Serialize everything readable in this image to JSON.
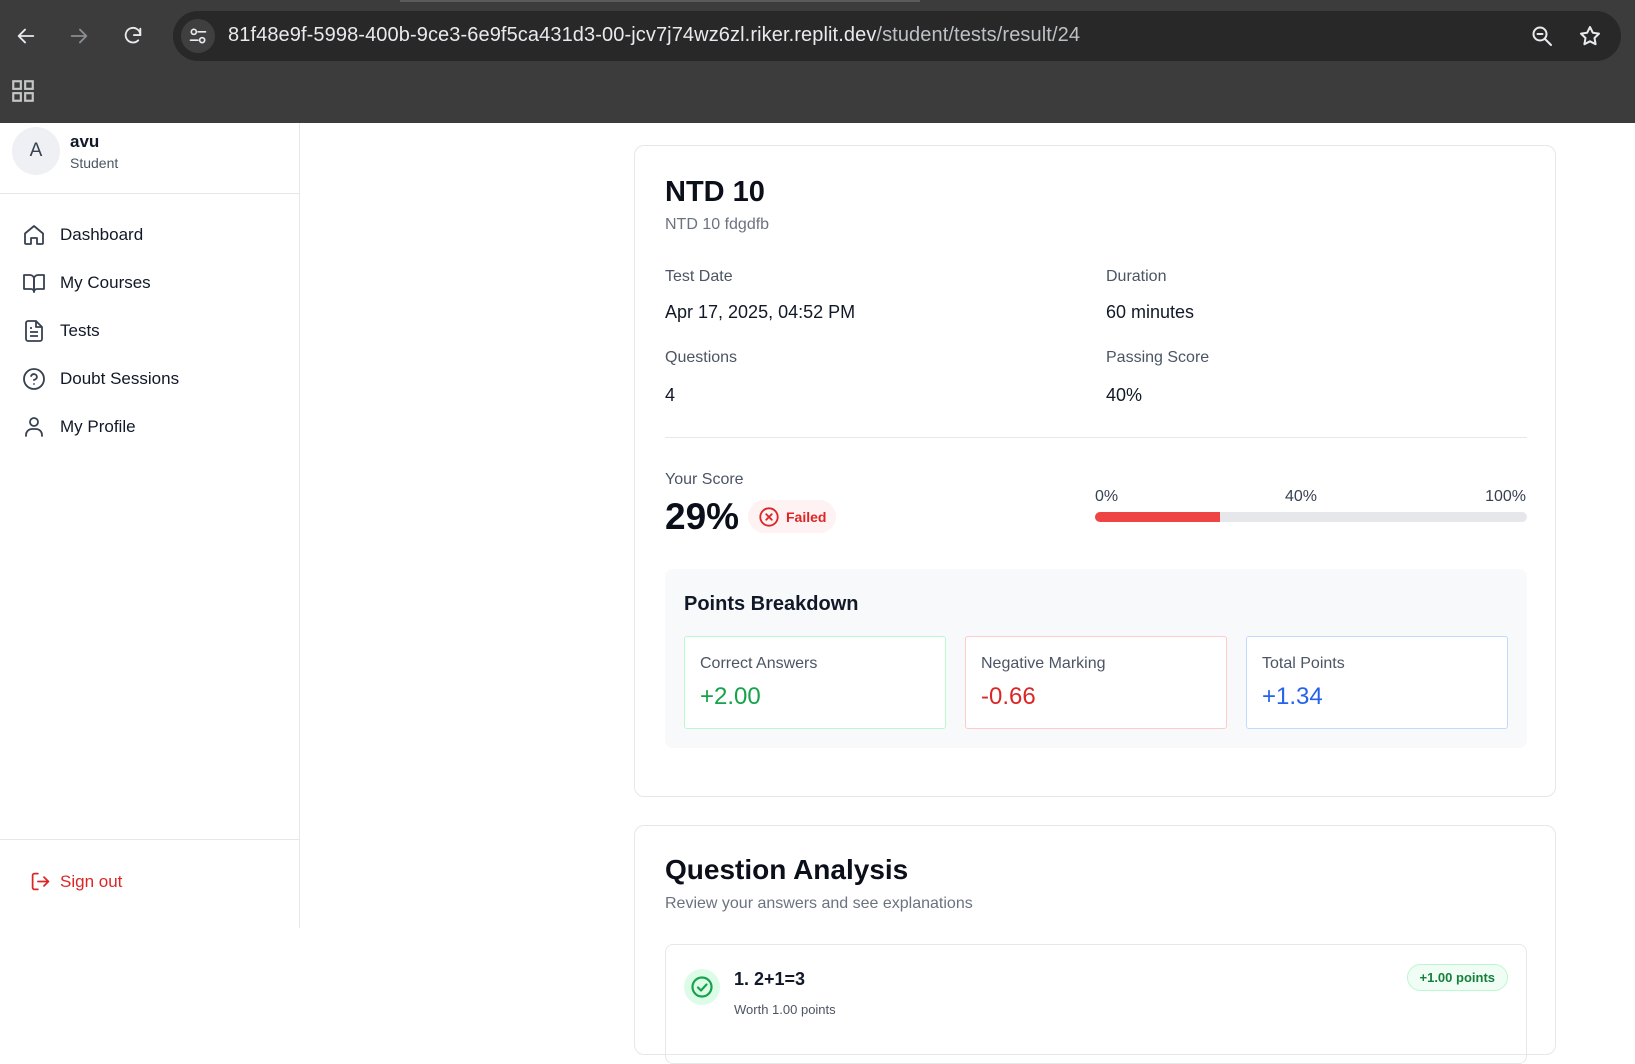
{
  "browser": {
    "url_host": "81f48e9f-5998-400b-9ce3-6e9f5ca431d3-00-jcv7j74wz6zl.riker.replit.dev",
    "url_path": "/student/tests/result/24"
  },
  "user": {
    "avatar_initial": "A",
    "name": "avu",
    "role": "Student"
  },
  "sidebar": {
    "items": [
      {
        "label": "Dashboard",
        "icon": "home-icon"
      },
      {
        "label": "My Courses",
        "icon": "book-icon"
      },
      {
        "label": "Tests",
        "icon": "file-text-icon"
      },
      {
        "label": "Doubt Sessions",
        "icon": "help-circle-icon"
      },
      {
        "label": "My Profile",
        "icon": "user-icon"
      }
    ],
    "signout_label": "Sign out"
  },
  "test": {
    "title": "NTD 10",
    "subtitle": "NTD 10 fdgdfb",
    "test_date_label": "Test Date",
    "test_date": "Apr 17, 2025, 04:52 PM",
    "duration_label": "Duration",
    "duration": "60 minutes",
    "questions_label": "Questions",
    "questions": "4",
    "passing_label": "Passing Score",
    "passing": "40%"
  },
  "score": {
    "label": "Your Score",
    "value": "29%",
    "percent": 29,
    "status": "Failed",
    "bar_min_label": "0%",
    "bar_pass_label": "40%",
    "bar_max_label": "100%"
  },
  "breakdown": {
    "title": "Points Breakdown",
    "correct_label": "Correct Answers",
    "correct_value": "+2.00",
    "negative_label": "Negative Marking",
    "negative_value": "-0.66",
    "total_label": "Total Points",
    "total_value": "+1.34"
  },
  "analysis": {
    "title": "Question Analysis",
    "subtitle": "Review your answers and see explanations",
    "questions": [
      {
        "text": "1. 2+1=3",
        "worth": "Worth 1.00 points",
        "points": "+1.00 points"
      }
    ]
  },
  "colors": {
    "danger": "#dc2626",
    "success": "#16a34a",
    "info": "#2563eb"
  }
}
